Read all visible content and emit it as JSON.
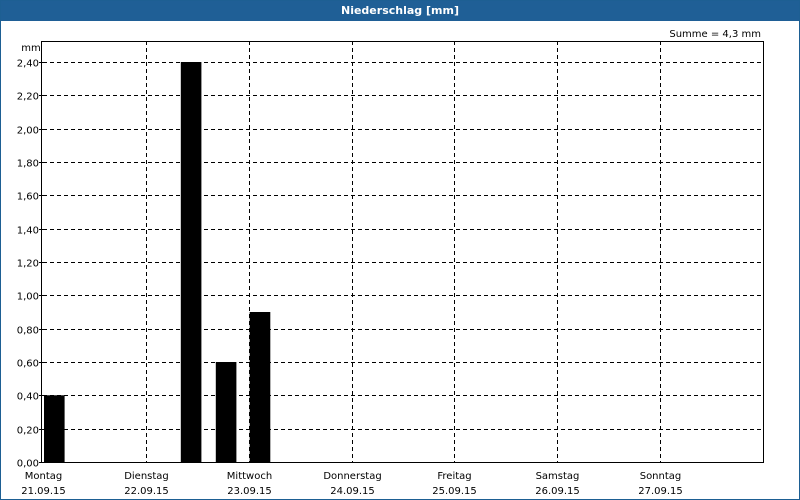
{
  "chart_data": {
    "type": "bar",
    "title": "Niederschlag [mm]",
    "unit": "mm",
    "sum_label": "Summe = 4,3 mm",
    "ylim": [
      0,
      2.5
    ],
    "y_ticks": [
      0,
      0.2,
      0.4,
      0.6,
      0.8,
      1.0,
      1.2,
      1.4,
      1.6,
      1.8,
      2.0,
      2.2,
      2.4
    ],
    "y_tick_labels": [
      "0,00",
      "0,20",
      "0,40",
      "0,60",
      "0,80",
      "1,00",
      "1,20",
      "1,40",
      "1,60",
      "1,80",
      "2,00",
      "2,20",
      "2,40"
    ],
    "x_range": [
      0,
      7
    ],
    "days": [
      {
        "weekday": "Montag",
        "date": "21.09.15",
        "x": 0
      },
      {
        "weekday": "Dienstag",
        "date": "22.09.15",
        "x": 1
      },
      {
        "weekday": "Mittwoch",
        "date": "23.09.15",
        "x": 2
      },
      {
        "weekday": "Donnerstag",
        "date": "24.09.15",
        "x": 3
      },
      {
        "weekday": "Freitag",
        "date": "25.09.15",
        "x": 4
      },
      {
        "weekday": "Samstag",
        "date": "26.09.15",
        "x": 5
      },
      {
        "weekday": "Sonntag",
        "date": "27.09.15",
        "x": 6
      }
    ],
    "bars": [
      {
        "x_start": 0.0,
        "x_end": 0.2,
        "value": 0.4
      },
      {
        "x_start": 1.33,
        "x_end": 1.53,
        "value": 2.4
      },
      {
        "x_start": 1.67,
        "x_end": 1.87,
        "value": 0.6
      },
      {
        "x_start": 2.0,
        "x_end": 2.2,
        "value": 0.9
      }
    ],
    "grid": true,
    "bar_color": "#000000",
    "grid_color": "#000000"
  }
}
